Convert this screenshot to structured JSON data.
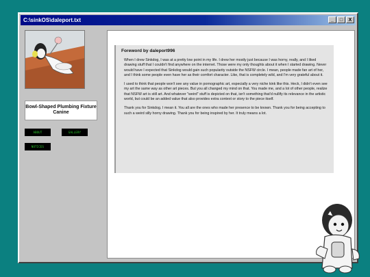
{
  "window": {
    "title": "C:\\sinkOS\\daleport.txt",
    "controls": {
      "minimize": "_",
      "maximize": "□",
      "close": "X"
    }
  },
  "sidebar": {
    "thumbnail_icon": "artwork-thumbnail",
    "art_title": "Bowl-Shaped Plumbing Fixture Canine",
    "buttons": [
      {
        "label": "ABOUT"
      },
      {
        "label": "GALLERY"
      },
      {
        "label": "NOTICES"
      }
    ]
  },
  "foreword": {
    "heading": "Foreword by daleport996",
    "paragraphs": [
      "When I drew Sinkdog, I was at a pretty low point in my life. I drew her mostly just because I was horny, really, and I liked drawing stuff that I couldn't find anywhere on the internet. Those were my only thoughts about it when I started drawing. Never would have I expected that Sinkdog would gain such popularity outside the NSFW circle. I mean, people made fan art of her, and I think some people even have her as their comfort character. Like, that is completely wild, and I'm very grateful about it.",
      "I used to think that people won't see any value in pornographic art, especially a very niche kink like this. Heck, I didn't even see my art the same way as other art pieces. But you all changed my mind on that. You made me, and a lot of other people, realize that NSFW art is still art. And whatever \"weird\" stuff is depicted on that, isn't something that'd nullify its relevance in the artistic world, but could be an added value that also provides extra context or story to the piece itself.",
      "Thank you for Sinkdog. I mean it. You all are the ones who made her presence to be known. Thank you for being accepting to such a weird silly horny drawing. Thank you for being inspired by her. It truly means a lot."
    ]
  },
  "mascot_icon": "sinkdog-mascot",
  "colors": {
    "desktop": "#0b8080",
    "titlebar": "#000a88",
    "window": "#c4c4c4",
    "button_text": "#2ed12e"
  }
}
